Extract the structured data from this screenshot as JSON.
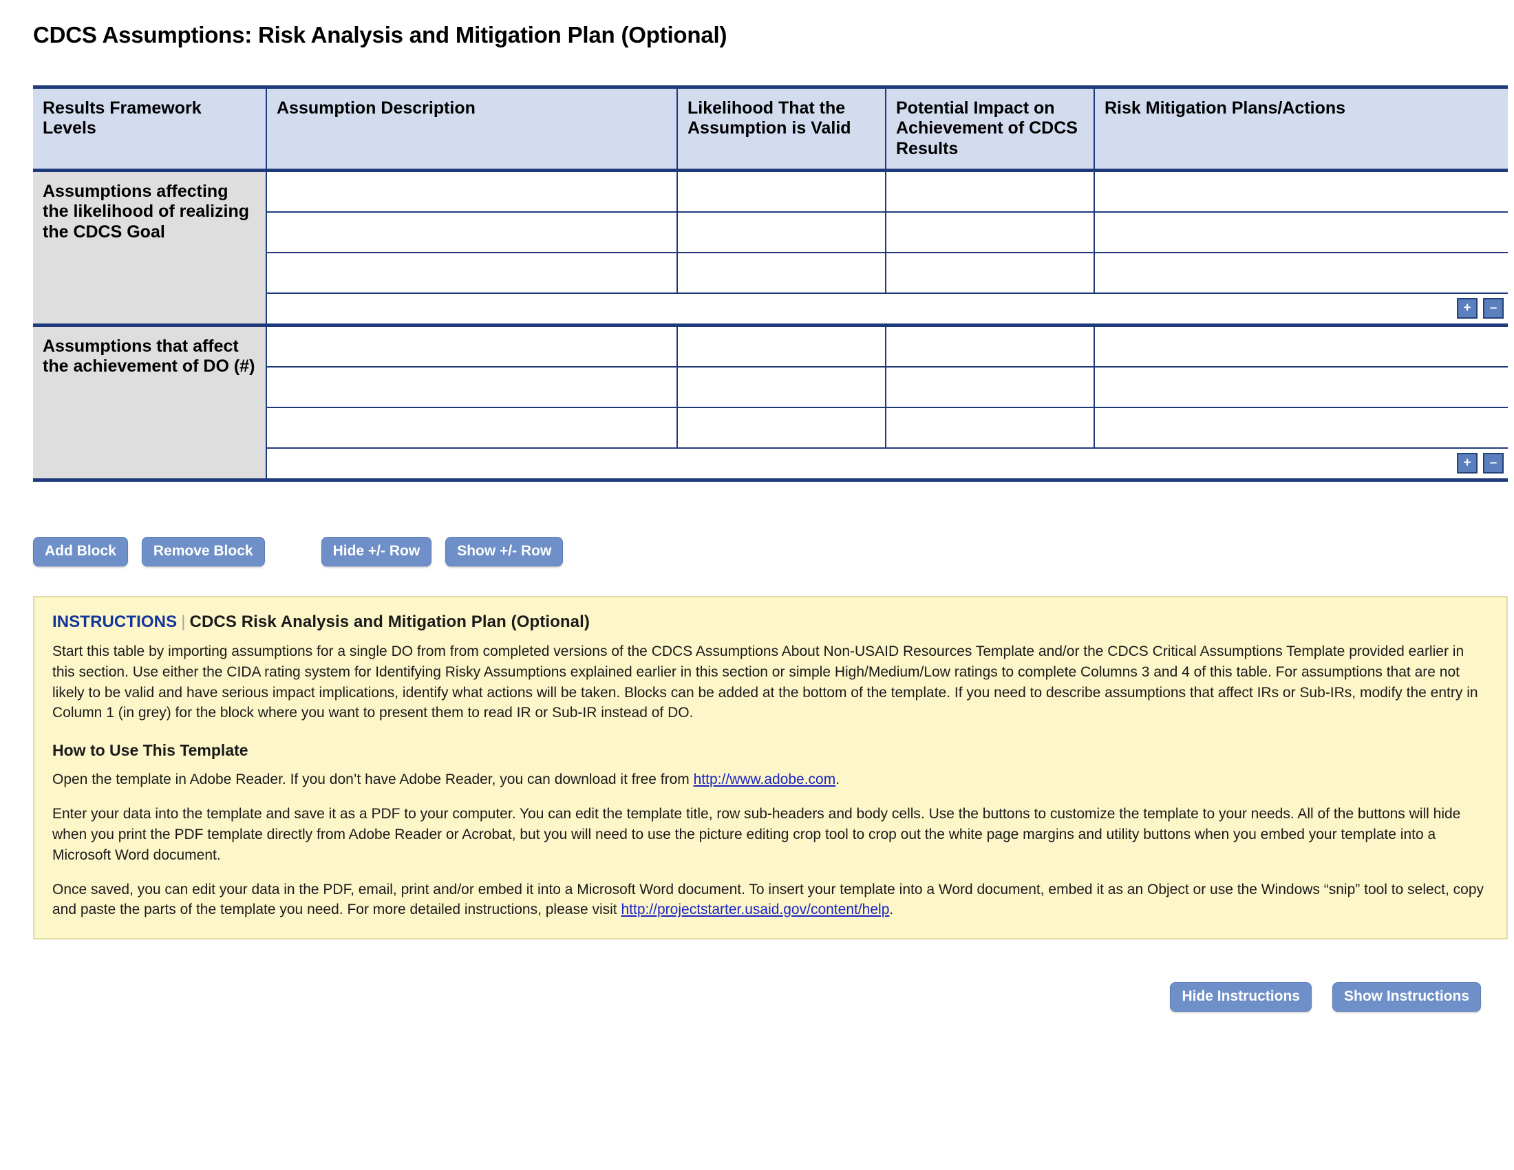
{
  "title": "CDCS Assumptions: Risk Analysis and Mitigation Plan (Optional)",
  "table": {
    "headers": [
      "Results Framework Levels",
      "Assumption Description",
      "Likelihood That the Assumption is Valid",
      "Potential Impact on Achievement of CDCS Results",
      "Risk Mitigation Plans/Actions"
    ],
    "blocks": [
      {
        "label": "Assumptions affecting the likelihood of realizing the CDCS Goal",
        "row_count": 3,
        "add_row_label": "+",
        "remove_row_label": "–"
      },
      {
        "label": "Assumptions that affect the achievement of DO (#)",
        "row_count": 3,
        "add_row_label": "+",
        "remove_row_label": "–"
      }
    ]
  },
  "toolbar": {
    "add_block": "Add Block",
    "remove_block": "Remove Block",
    "hide_pm_row": "Hide +/- Row",
    "show_pm_row": "Show +/- Row"
  },
  "instructions": {
    "label": "INSTRUCTIONS",
    "separator": "|",
    "heading": "CDCS Risk Analysis and Mitigation Plan (Optional)",
    "paragraph1": "Start this table by importing assumptions for a single DO from from completed versions of the CDCS Assumptions About Non-USAID Resources Template and/or the CDCS Critical Assumptions Template provided earlier in this section. Use either the CIDA rating system for Identifying Risky Assumptions explained earlier in this section or simple High/Medium/Low ratings to complete Columns 3 and 4 of this table. For assumptions that are not likely to be valid and have serious impact implications, identify what actions will be taken. Blocks can be added at the bottom of the template. If you need to describe assumptions that affect IRs or Sub-IRs, modify the entry in Column 1 (in grey) for the block where you want to present them to read IR or Sub-IR instead of DO.",
    "how_to_heading": "How to Use This Template",
    "howto1_pre": "Open the template in Adobe Reader. If you don’t have Adobe Reader, you can download it free from ",
    "howto1_link": "http://www.adobe.com",
    "howto1_post": ".",
    "howto2": "Enter your data into the template and save it as a PDF to your computer. You can edit the template title, row sub-headers and body cells. Use the buttons to customize the template to your needs. All of the buttons will hide when you print the PDF template directly from Adobe Reader or Acrobat, but you will need to use the picture editing crop tool to crop out the white page margins and utility buttons when you embed your template into a Microsoft Word document.",
    "howto3_pre": "Once saved, you can edit your data in the PDF, email, print and/or embed it into a Microsoft Word document. To insert your template into a Word document, embed it as an Object or use the Windows “snip” tool to select, copy and paste the parts of the template you need. For more detailed instructions, please visit ",
    "howto3_link": "http://projectstarter.usaid.gov/content/help",
    "howto3_post": "."
  },
  "footer": {
    "hide_instructions": "Hide Instructions",
    "show_instructions": "Show Instructions"
  },
  "colors": {
    "header_fill": "#d3dcef",
    "block_label_fill": "#dedede",
    "rule": "#1f3a7a",
    "button": "#6e8fc7",
    "instructions_fill": "#fdf6c9",
    "link": "#1a23c4"
  }
}
